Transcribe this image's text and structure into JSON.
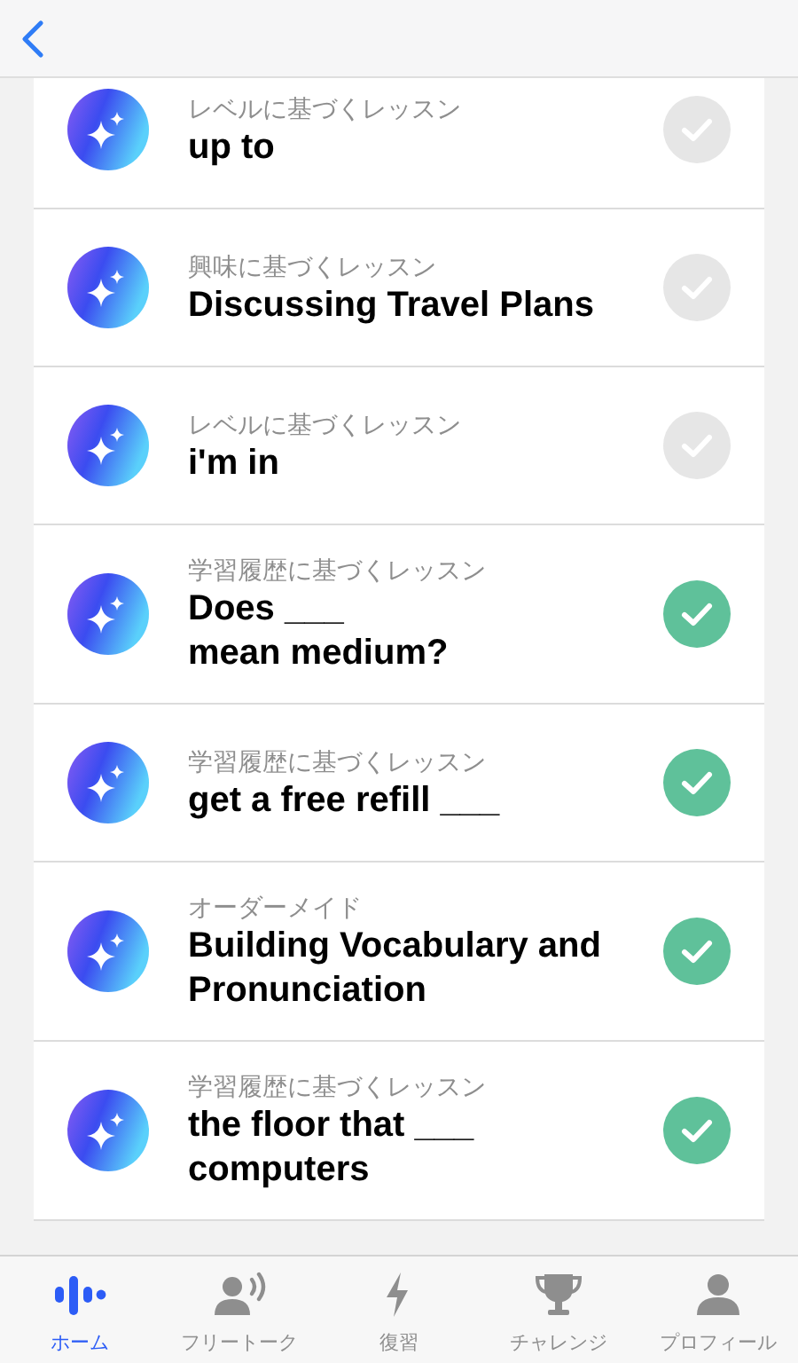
{
  "lessons": [
    {
      "category": "レベルに基づくレッスン",
      "title": "up to",
      "completed": false
    },
    {
      "category": "興味に基づくレッスン",
      "title": "Discussing Travel Plans",
      "completed": false
    },
    {
      "category": "レベルに基づくレッスン",
      "title": "i'm in",
      "completed": false
    },
    {
      "category": "学習履歴に基づくレッスン",
      "title": "Does ___\nmean medium?",
      "completed": true
    },
    {
      "category": "学習履歴に基づくレッスン",
      "title": "get a free refill ___",
      "completed": true
    },
    {
      "category": "オーダーメイド",
      "title": "Building Vocabulary and Pronunciation",
      "completed": true
    },
    {
      "category": "学習履歴に基づくレッスン",
      "title": "the floor that ___\ncomputers",
      "completed": true
    }
  ],
  "tab_bar": [
    {
      "kind": "home",
      "label": "ホーム",
      "selected": true
    },
    {
      "kind": "talk",
      "label": "フリートーク",
      "selected": false
    },
    {
      "kind": "review",
      "label": "復習",
      "selected": false
    },
    {
      "kind": "challenge",
      "label": "チャレンジ",
      "selected": false
    },
    {
      "kind": "profile",
      "label": "プロフィール",
      "selected": false
    }
  ]
}
